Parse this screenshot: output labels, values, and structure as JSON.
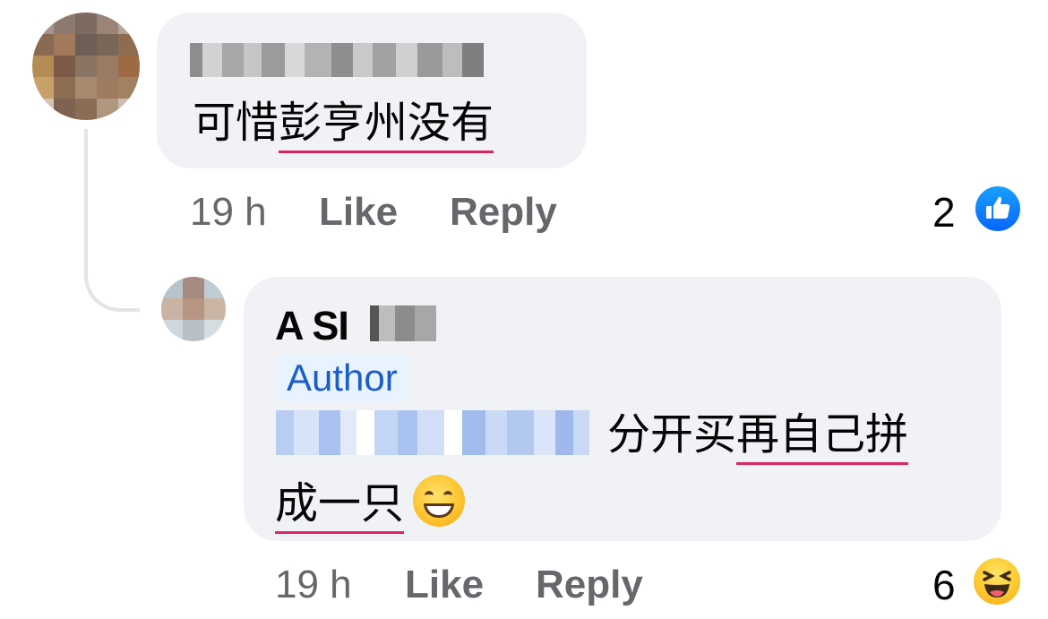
{
  "colors": {
    "bubble_bg": "#f0f2f5",
    "meta_text": "#65676b",
    "author_badge_bg": "#e7f3ff",
    "author_badge_text": "#1b5ec8",
    "like_blue": "#0866ff",
    "squiggle_red": "#e0245e"
  },
  "comment1": {
    "avatar": "blurred-profile-photo",
    "name_redacted": true,
    "text_plain": "可惜",
    "text_underlined": "彭亨州没有",
    "time": "19 h",
    "like_label": "Like",
    "reply_label": "Reply",
    "reaction_count": "2",
    "reaction_icon": "like-thumbs-up-icon"
  },
  "comment2": {
    "avatar": "blurred-profile-photo",
    "name": "A SI",
    "name_partially_redacted": true,
    "badge": "Author",
    "text_redacted_prefix": true,
    "text_line1_plain": "分开买",
    "text_line1_underlined": "再自己拼",
    "text_line2_underlined": "成一只",
    "text_emoji": "grinning-face-icon",
    "time": "19 h",
    "like_label": "Like",
    "reply_label": "Reply",
    "reaction_count": "6",
    "reaction_icon": "haha-icon"
  }
}
